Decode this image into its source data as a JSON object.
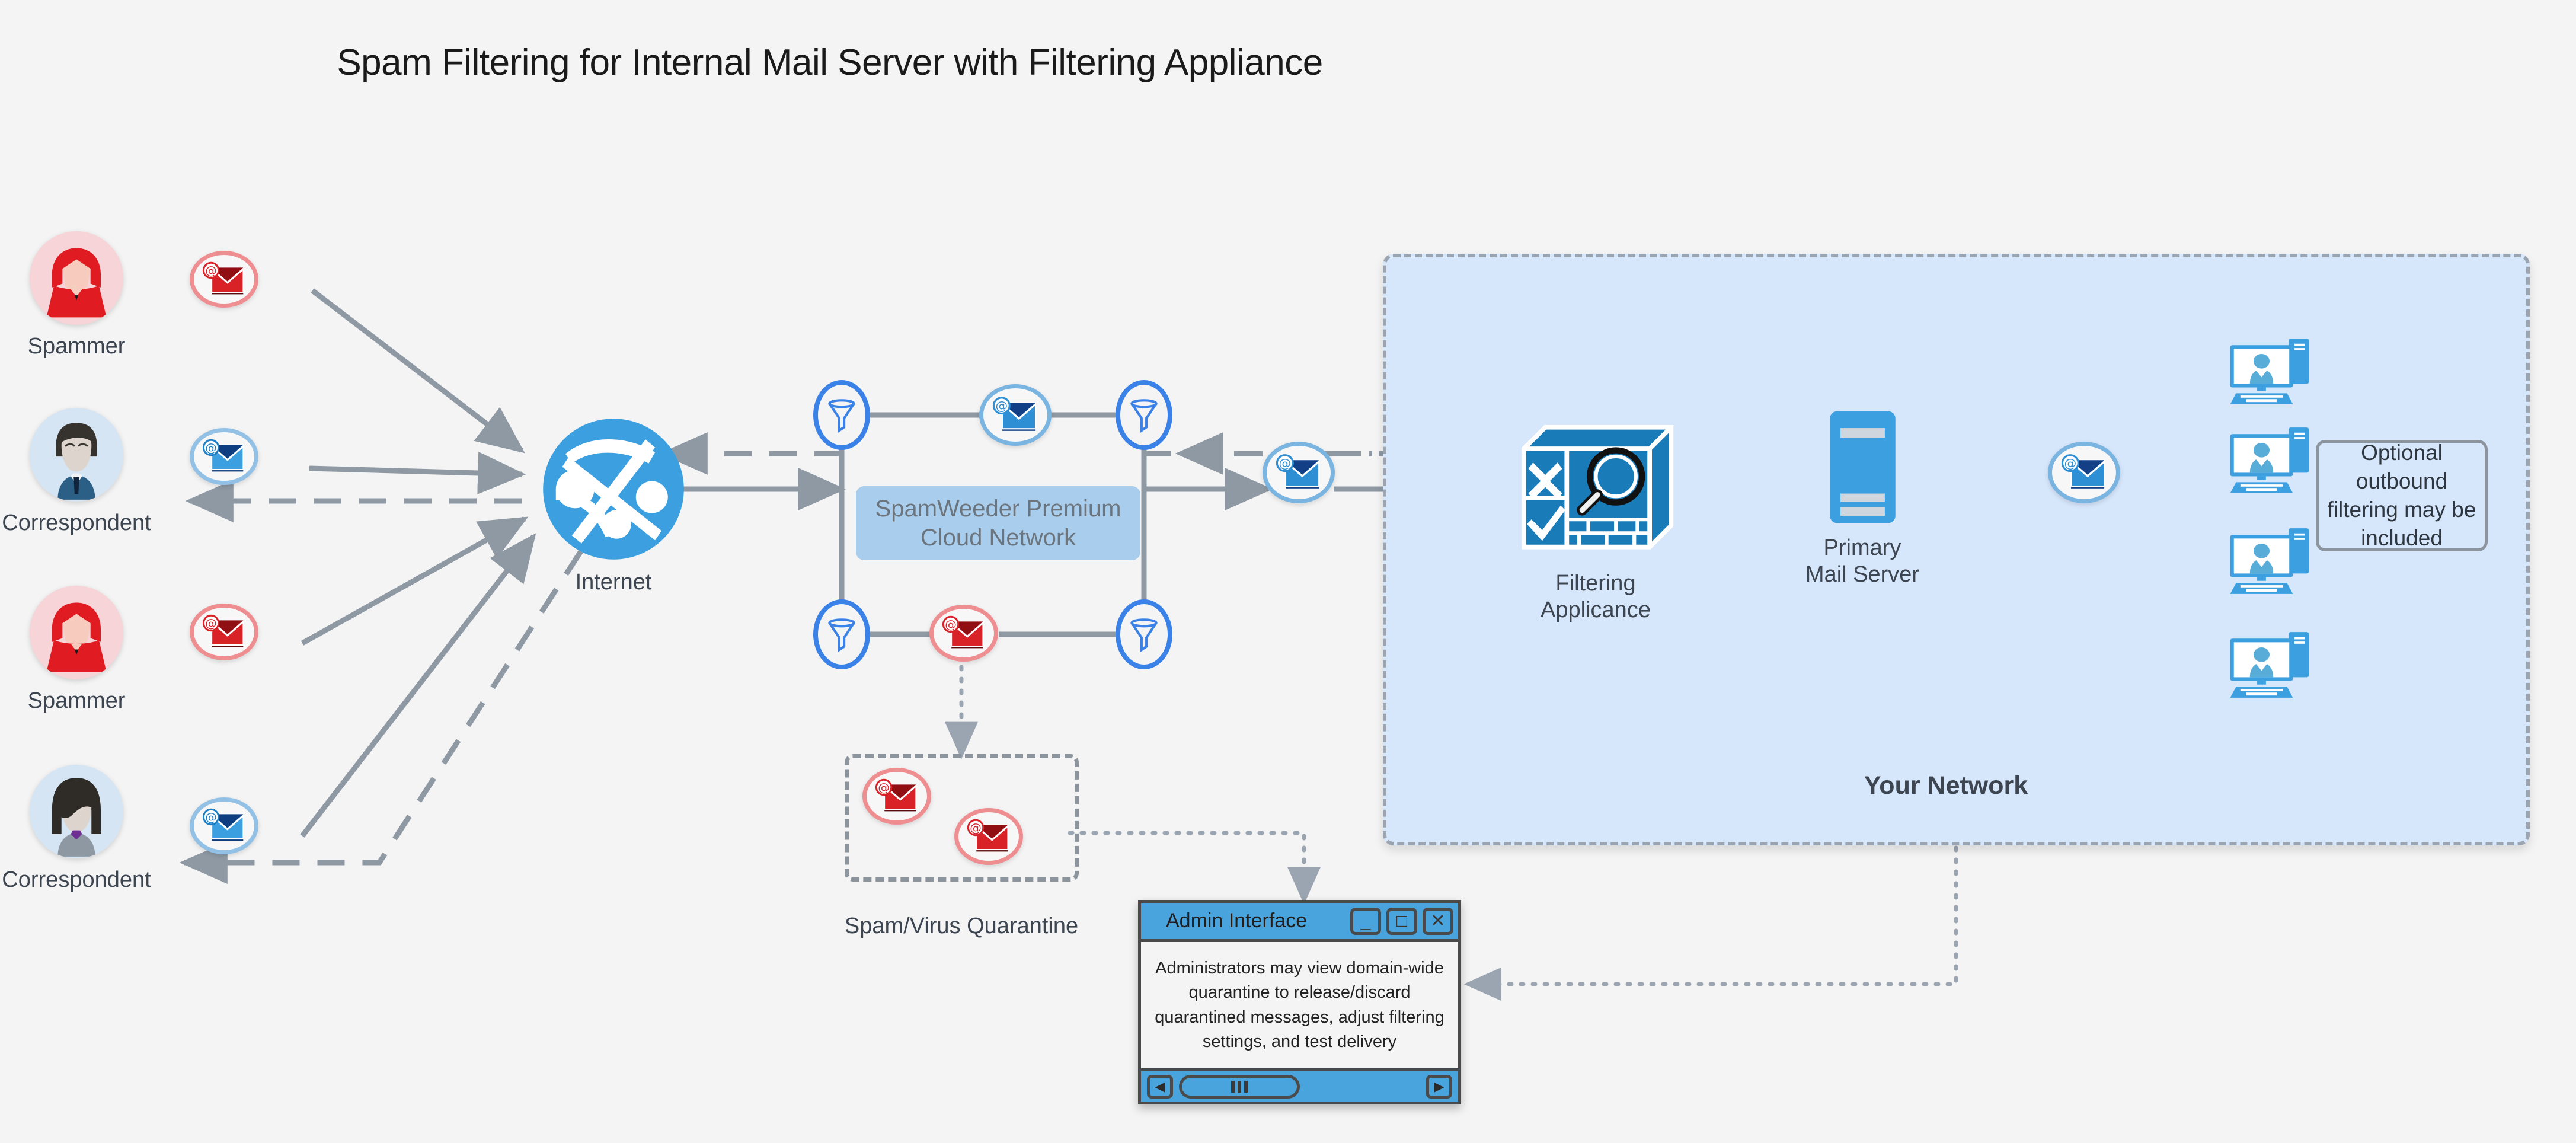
{
  "title": "Spam Filtering for Internal Mail Server with Filtering Appliance",
  "colors": {
    "background": "#f4f4f4",
    "network_panel_fill": "#d6e6fb",
    "cloud_box_fill": "#a8cded",
    "accent_blue": "#3b9fe0",
    "filter_blue": "#3b82e8",
    "spam_red": "#d92128",
    "connector_gray": "#8e99a4",
    "title_bar_blue": "#49a3dd",
    "appliance_blue": "#1a7bb9"
  },
  "actors": [
    {
      "label": "Spammer",
      "type": "spammer-red-hoodie",
      "mail": "spam-mail-red"
    },
    {
      "label": "Correspondent",
      "type": "correspondent-male",
      "mail": "mail-blue"
    },
    {
      "label": "Spammer",
      "type": "spammer-red-hoodie",
      "mail": "spam-mail-red"
    },
    {
      "label": "Correspondent",
      "type": "correspondent-female",
      "mail": "mail-blue"
    }
  ],
  "internet": {
    "label": "Internet",
    "icon": "globe-network-icon"
  },
  "cloud": {
    "label": "SpamWeeder Premium\nCloud Network",
    "filters": [
      {
        "name": "filter-top-left",
        "icon": "funnel-icon"
      },
      {
        "name": "filter-top-right",
        "icon": "funnel-icon"
      },
      {
        "name": "filter-bottom-left",
        "icon": "funnel-icon"
      },
      {
        "name": "filter-bottom-right",
        "icon": "funnel-icon"
      }
    ],
    "clean_mail_icon": "mail-blue",
    "spam_mail_icon": "spam-mail-red"
  },
  "quarantine": {
    "label": "Spam/Virus Quarantine",
    "items": [
      "spam-mail-red",
      "spam-mail-red"
    ]
  },
  "admin_window": {
    "title": "Admin Interface",
    "body": "Administrators may view domain-wide quarantine to release/discard quarantined messages, adjust filtering settings, and test delivery",
    "buttons": {
      "minimize": "_",
      "maximize": "□",
      "close": "✕"
    },
    "scroll": {
      "left": "◀",
      "right": "▶"
    }
  },
  "network": {
    "label": "Your Network",
    "appliance": {
      "label": "Filtering\nApplicance",
      "icon": "firewall-inspect-icon"
    },
    "mail_server": {
      "label": "Primary\nMail Server",
      "icon": "server-tower-icon"
    },
    "inbox_mail_icon": "mail-blue",
    "workstations": [
      {
        "name": "workstation-1",
        "icon": "desktop-user-icon"
      },
      {
        "name": "workstation-2",
        "icon": "desktop-user-icon"
      },
      {
        "name": "workstation-3",
        "icon": "desktop-user-icon"
      },
      {
        "name": "workstation-4",
        "icon": "desktop-user-icon"
      }
    ],
    "note": "Optional outbound filtering may be included"
  }
}
